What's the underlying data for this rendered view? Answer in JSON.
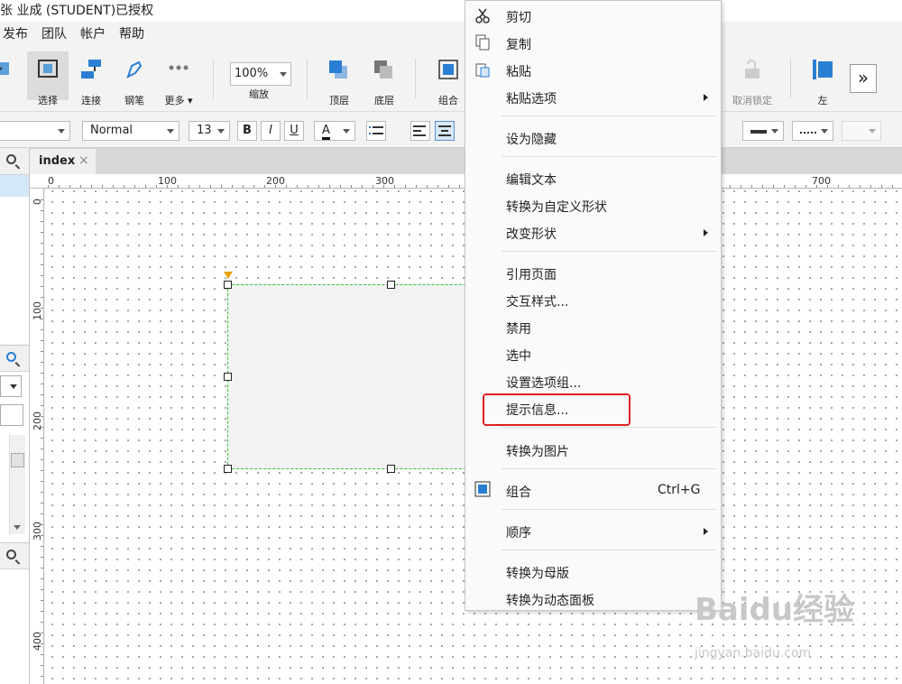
{
  "window": {
    "title": "张 业成 (STUDENT)已授权"
  },
  "menubar": [
    "发布",
    "团队",
    "帐户",
    "帮助"
  ],
  "toolbar": {
    "select": "选择",
    "connect": "连接",
    "pen": "钢笔",
    "more": "更多 ▾",
    "zoom_value": "100%",
    "zoom_label": "缩放",
    "bring_front": "顶层",
    "send_back": "底层",
    "group": "组合",
    "unlock": "取消锁定",
    "align_left": "左",
    "expand": "»"
  },
  "formatbar": {
    "style_value": "Normal",
    "font_size": "13",
    "bold": "B",
    "italic": "I",
    "underline": "U",
    "font_color": "A"
  },
  "tabs": [
    {
      "label": "index",
      "close": "×"
    }
  ],
  "ruler": {
    "h": [
      "0",
      "100",
      "200",
      "300",
      "700"
    ],
    "v": [
      "0",
      "100",
      "200",
      "300",
      "400"
    ]
  },
  "context_menu": {
    "items": [
      {
        "label": "剪切",
        "icon": "scissors-icon"
      },
      {
        "label": "复制",
        "icon": "copy-icon"
      },
      {
        "label": "粘贴",
        "icon": "paste-icon"
      },
      {
        "label": "粘贴选项",
        "submenu": true
      },
      {
        "label": "设为隐藏"
      },
      {
        "label": "编辑文本"
      },
      {
        "label": "转换为自定义形状"
      },
      {
        "label": "改变形状",
        "submenu": true
      },
      {
        "label": "引用页面"
      },
      {
        "label": "交互样式..."
      },
      {
        "label": "禁用"
      },
      {
        "label": "选中"
      },
      {
        "label": "设置选项组..."
      },
      {
        "label": "提示信息...",
        "highlighted": true
      },
      {
        "label": "转换为图片"
      },
      {
        "label": "组合",
        "shortcut": "Ctrl+G",
        "icon": "group-icon"
      },
      {
        "label": "顺序",
        "submenu": true
      },
      {
        "label": "转换为母版"
      },
      {
        "label": "转换为动态面板"
      }
    ]
  },
  "watermark": {
    "logo": "Baidu经验",
    "url": "jingyan.baidu.com"
  },
  "colors": {
    "highlight": "#e02020",
    "selection": "#2fc92f",
    "accent": "#2a7fd4"
  }
}
